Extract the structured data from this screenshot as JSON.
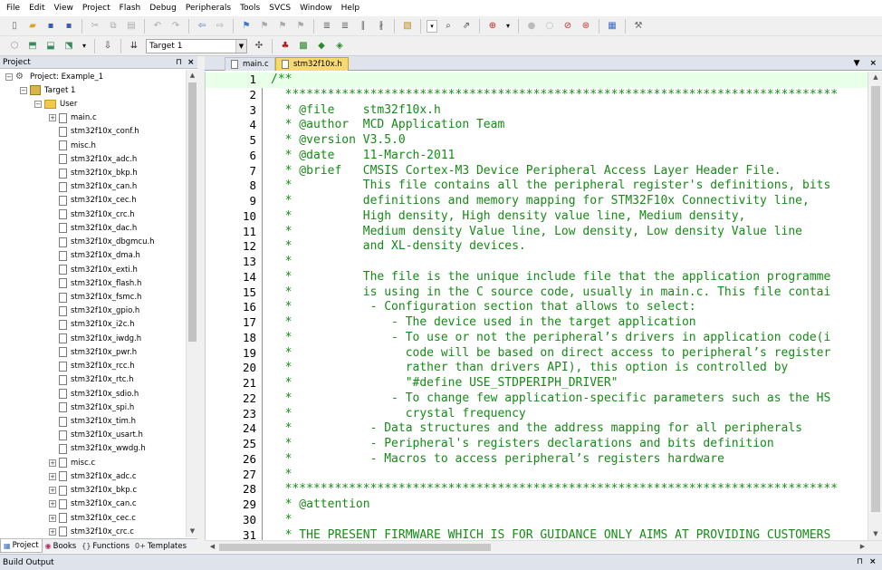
{
  "menu": [
    "File",
    "Edit",
    "View",
    "Project",
    "Flash",
    "Debug",
    "Peripherals",
    "Tools",
    "SVCS",
    "Window",
    "Help"
  ],
  "toolbar": {
    "row1_icons": [
      "new-file-icon",
      "open-icon",
      "save-icon",
      "save-all-icon",
      "|",
      "cut-icon",
      "copy-icon",
      "paste-icon",
      "|",
      "undo-icon",
      "redo-icon",
      "|",
      "nav-back-icon",
      "nav-forward-icon",
      "|",
      "bookmark-icon",
      "bookmark-prev-icon",
      "bookmark-next-icon",
      "bookmark-clear-icon",
      "|",
      "indent-icon",
      "unindent-icon",
      "comment-icon",
      "uncomment-icon",
      "|",
      "find-in-files-icon",
      "|",
      "combo",
      "search-icon",
      "incremental-find-icon",
      "|",
      "debug-start-icon",
      "dropdown",
      "|",
      "breakpoint-icon",
      "breakpoint-disable-icon",
      "breakpoint-kill-icon",
      "breakpoint-kill-all-icon",
      "|",
      "window-layout-icon",
      "|",
      "configure-icon"
    ],
    "row2_icons": [
      "translate-icon",
      "build-icon",
      "rebuild-icon",
      "batch-build-icon",
      "dropdown",
      "|",
      "download-icon",
      "|",
      "stop-build-icon"
    ],
    "target": "Target 1",
    "row2_icons_after": [
      "target-options-icon",
      "|",
      "manage-project-icon",
      "manage-packs-icon",
      "select-pack-icon",
      "manage-rte-icon"
    ]
  },
  "project_panel": {
    "title": "Project",
    "tree": [
      {
        "label": "Project: Example_1",
        "level": 0,
        "kind": "project",
        "expander": "−"
      },
      {
        "label": "Target 1",
        "level": 1,
        "kind": "target",
        "expander": "−"
      },
      {
        "label": "User",
        "level": 2,
        "kind": "folder",
        "expander": "−"
      },
      {
        "label": "main.c",
        "level": 3,
        "kind": "file",
        "expander": "+"
      },
      {
        "label": "stm32f10x_conf.h",
        "level": 3,
        "kind": "file",
        "expander": ""
      },
      {
        "label": "misc.h",
        "level": 3,
        "kind": "file",
        "expander": ""
      },
      {
        "label": "stm32f10x_adc.h",
        "level": 3,
        "kind": "file",
        "expander": ""
      },
      {
        "label": "stm32f10x_bkp.h",
        "level": 3,
        "kind": "file",
        "expander": ""
      },
      {
        "label": "stm32f10x_can.h",
        "level": 3,
        "kind": "file",
        "expander": ""
      },
      {
        "label": "stm32f10x_cec.h",
        "level": 3,
        "kind": "file",
        "expander": ""
      },
      {
        "label": "stm32f10x_crc.h",
        "level": 3,
        "kind": "file",
        "expander": ""
      },
      {
        "label": "stm32f10x_dac.h",
        "level": 3,
        "kind": "file",
        "expander": ""
      },
      {
        "label": "stm32f10x_dbgmcu.h",
        "level": 3,
        "kind": "file",
        "expander": ""
      },
      {
        "label": "stm32f10x_dma.h",
        "level": 3,
        "kind": "file",
        "expander": ""
      },
      {
        "label": "stm32f10x_exti.h",
        "level": 3,
        "kind": "file",
        "expander": ""
      },
      {
        "label": "stm32f10x_flash.h",
        "level": 3,
        "kind": "file",
        "expander": ""
      },
      {
        "label": "stm32f10x_fsmc.h",
        "level": 3,
        "kind": "file",
        "expander": ""
      },
      {
        "label": "stm32f10x_gpio.h",
        "level": 3,
        "kind": "file",
        "expander": ""
      },
      {
        "label": "stm32f10x_i2c.h",
        "level": 3,
        "kind": "file",
        "expander": ""
      },
      {
        "label": "stm32f10x_iwdg.h",
        "level": 3,
        "kind": "file",
        "expander": ""
      },
      {
        "label": "stm32f10x_pwr.h",
        "level": 3,
        "kind": "file",
        "expander": ""
      },
      {
        "label": "stm32f10x_rcc.h",
        "level": 3,
        "kind": "file",
        "expander": ""
      },
      {
        "label": "stm32f10x_rtc.h",
        "level": 3,
        "kind": "file",
        "expander": ""
      },
      {
        "label": "stm32f10x_sdio.h",
        "level": 3,
        "kind": "file",
        "expander": ""
      },
      {
        "label": "stm32f10x_spi.h",
        "level": 3,
        "kind": "file",
        "expander": ""
      },
      {
        "label": "stm32f10x_tim.h",
        "level": 3,
        "kind": "file",
        "expander": ""
      },
      {
        "label": "stm32f10x_usart.h",
        "level": 3,
        "kind": "file",
        "expander": ""
      },
      {
        "label": "stm32f10x_wwdg.h",
        "level": 3,
        "kind": "file",
        "expander": ""
      },
      {
        "label": "misc.c",
        "level": 3,
        "kind": "file",
        "expander": "+"
      },
      {
        "label": "stm32f10x_adc.c",
        "level": 3,
        "kind": "file",
        "expander": "+"
      },
      {
        "label": "stm32f10x_bkp.c",
        "level": 3,
        "kind": "file",
        "expander": "+"
      },
      {
        "label": "stm32f10x_can.c",
        "level": 3,
        "kind": "file",
        "expander": "+"
      },
      {
        "label": "stm32f10x_cec.c",
        "level": 3,
        "kind": "file",
        "expander": "+"
      },
      {
        "label": "stm32f10x_crc.c",
        "level": 3,
        "kind": "file",
        "expander": "+"
      }
    ],
    "bottom_tabs": [
      {
        "label": "Project",
        "icon": "project-tab-icon",
        "active": true
      },
      {
        "label": "Books",
        "icon": "books-icon",
        "active": false
      },
      {
        "label": "Functions",
        "icon": "functions-icon",
        "active": false
      },
      {
        "label": "Templates",
        "icon": "templates-icon",
        "active": false
      }
    ]
  },
  "editor": {
    "tabs": [
      {
        "label": "main.c",
        "active": false
      },
      {
        "label": "stm32f10x.h",
        "active": true
      }
    ],
    "highlight_line": 1,
    "lines": [
      {
        "n": "1",
        "text": "/**"
      },
      {
        "n": "2",
        "text": "  ******************************************************************************"
      },
      {
        "n": "3",
        "text": "  * @file    stm32f10x.h"
      },
      {
        "n": "4",
        "text": "  * @author  MCD Application Team"
      },
      {
        "n": "5",
        "text": "  * @version V3.5.0"
      },
      {
        "n": "6",
        "text": "  * @date    11-March-2011"
      },
      {
        "n": "7",
        "text": "  * @brief   CMSIS Cortex-M3 Device Peripheral Access Layer Header File."
      },
      {
        "n": "8",
        "text": "  *          This file contains all the peripheral register's definitions, bits"
      },
      {
        "n": "9",
        "text": "  *          definitions and memory mapping for STM32F10x Connectivity line,"
      },
      {
        "n": "10",
        "text": "  *          High density, High density value line, Medium density,"
      },
      {
        "n": "11",
        "text": "  *          Medium density Value line, Low density, Low density Value line"
      },
      {
        "n": "12",
        "text": "  *          and XL-density devices."
      },
      {
        "n": "13",
        "text": "  *"
      },
      {
        "n": "14",
        "text": "  *          The file is the unique include file that the application programme"
      },
      {
        "n": "15",
        "text": "  *          is using in the C source code, usually in main.c. This file contai"
      },
      {
        "n": "16",
        "text": "  *           - Configuration section that allows to select:"
      },
      {
        "n": "17",
        "text": "  *              - The device used in the target application"
      },
      {
        "n": "18",
        "text": "  *              - To use or not the peripheral’s drivers in application code(i"
      },
      {
        "n": "19",
        "text": "  *                code will be based on direct access to peripheral’s register"
      },
      {
        "n": "20",
        "text": "  *                rather than drivers API), this option is controlled by"
      },
      {
        "n": "21",
        "text": "  *                \"#define USE_STDPERIPH_DRIVER\""
      },
      {
        "n": "22",
        "text": "  *              - To change few application-specific parameters such as the HS"
      },
      {
        "n": "23",
        "text": "  *                crystal frequency"
      },
      {
        "n": "24",
        "text": "  *           - Data structures and the address mapping for all peripherals"
      },
      {
        "n": "25",
        "text": "  *           - Peripheral's registers declarations and bits definition"
      },
      {
        "n": "26",
        "text": "  *           - Macros to access peripheral’s registers hardware"
      },
      {
        "n": "27",
        "text": "  *"
      },
      {
        "n": "28",
        "text": "  ******************************************************************************"
      },
      {
        "n": "29",
        "text": "  * @attention"
      },
      {
        "n": "30",
        "text": "  *"
      },
      {
        "n": "31",
        "text": "  * THE PRESENT FIRMWARE WHICH IS FOR GUIDANCE ONLY AIMS AT PROVIDING CUSTOMERS"
      }
    ]
  },
  "build_output": {
    "title": "Build Output"
  },
  "colors": {
    "comment_green": "#178a17",
    "active_tab": "#f7da6e",
    "panel_header": "#dfe4ec",
    "line_highlight": "#e8ffe8"
  }
}
